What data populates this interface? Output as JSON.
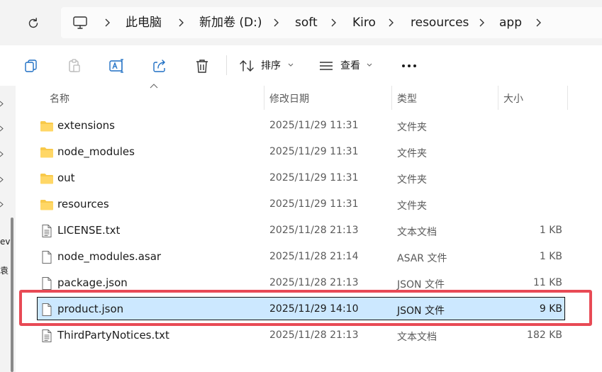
{
  "address": {
    "breadcrumbs": [
      "此电脑",
      "新加卷 (D:)",
      "soft",
      "Kiro",
      "resources",
      "app"
    ],
    "icons": {
      "computer": "computer-icon",
      "separator": "chevron-right-icon",
      "refresh": "refresh-icon"
    }
  },
  "toolbar": {
    "sort_label": "排序",
    "view_label": "查看",
    "icons": [
      "copy-icon",
      "paste-icon",
      "rename-icon",
      "share-icon",
      "delete-icon",
      "sort-icon",
      "view-icon",
      "more-icon"
    ]
  },
  "columns": {
    "name": "名称",
    "date": "修改日期",
    "type": "类型",
    "size": "大小"
  },
  "files": [
    {
      "name": "extensions",
      "date": "2025/11/29 11:31",
      "type": "文件夹",
      "size": "",
      "kind": "folder"
    },
    {
      "name": "node_modules",
      "date": "2025/11/29 11:31",
      "type": "文件夹",
      "size": "",
      "kind": "folder"
    },
    {
      "name": "out",
      "date": "2025/11/29 11:31",
      "type": "文件夹",
      "size": "",
      "kind": "folder"
    },
    {
      "name": "resources",
      "date": "2025/11/29 11:31",
      "type": "文件夹",
      "size": "",
      "kind": "folder"
    },
    {
      "name": "LICENSE.txt",
      "date": "2025/11/28 21:13",
      "type": "文本文档",
      "size": "1 KB",
      "kind": "text"
    },
    {
      "name": "node_modules.asar",
      "date": "2025/11/28 21:14",
      "type": "ASAR 文件",
      "size": "1 KB",
      "kind": "file"
    },
    {
      "name": "package.json",
      "date": "2025/11/28 21:13",
      "type": "JSON 文件",
      "size": "11 KB",
      "kind": "file"
    },
    {
      "name": "product.json",
      "date": "2025/11/29 14:10",
      "type": "JSON 文件",
      "size": "9 KB",
      "kind": "file",
      "selected": true
    },
    {
      "name": "ThirdPartyNotices.txt",
      "date": "2025/11/28 21:13",
      "type": "文本文档",
      "size": "182 KB",
      "kind": "text"
    }
  ],
  "leftnav": {
    "truncated": [
      "ev",
      "袁"
    ]
  },
  "colors": {
    "highlight": "#e84a55",
    "selection": "#cce8ff",
    "folder": "#f8c94a"
  }
}
